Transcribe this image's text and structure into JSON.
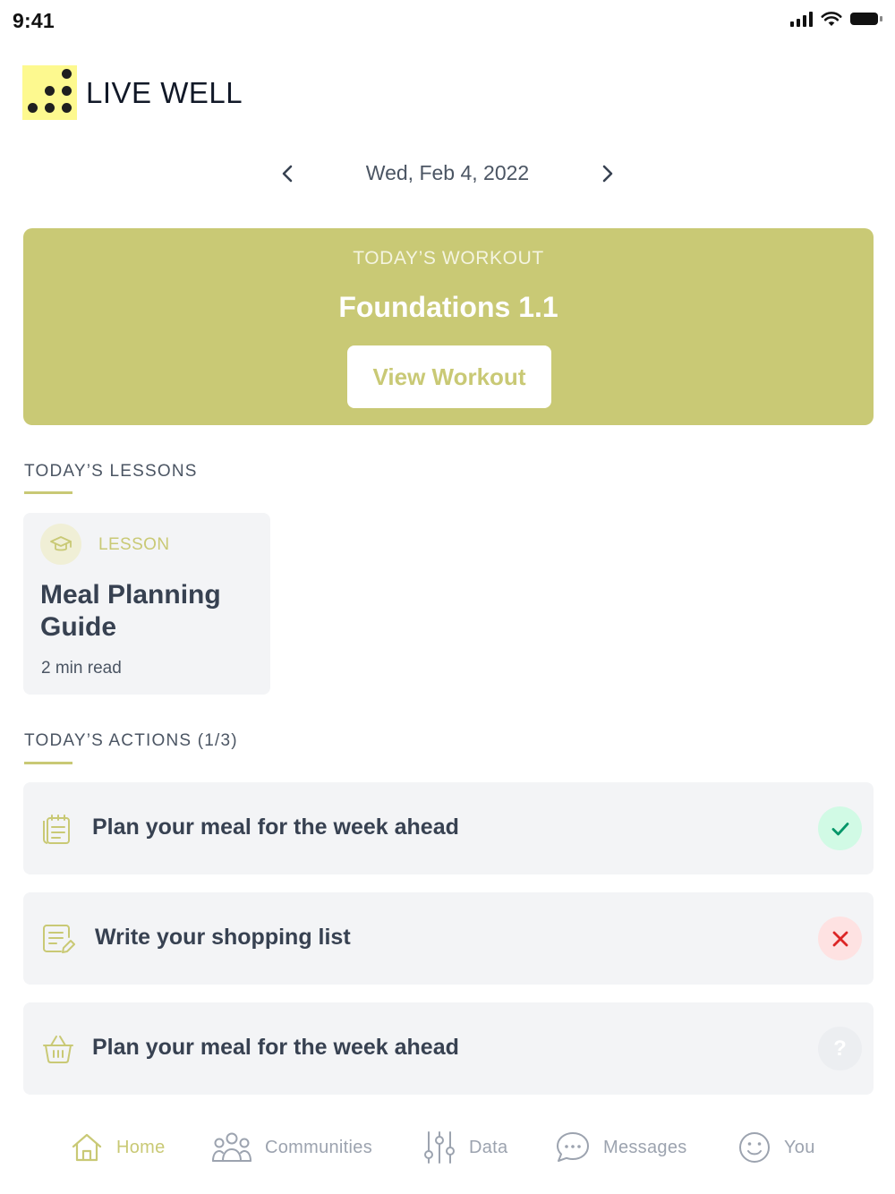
{
  "status_bar": {
    "time": "9:41"
  },
  "brand": {
    "name": "LIVE WELL"
  },
  "date_nav": {
    "date": "Wed, Feb 4, 2022"
  },
  "workout": {
    "eyebrow": "TODAY’S WORKOUT",
    "title": "Foundations 1.1",
    "button_label": "View Workout"
  },
  "lessons": {
    "heading": "TODAY’S LESSONS",
    "items": [
      {
        "tag": "LESSON",
        "title": "Meal Planning Guide",
        "meta": "2 min read",
        "icon": "graduation-cap-icon"
      }
    ]
  },
  "actions": {
    "heading": "TODAY’S ACTIONS (1/3)",
    "items": [
      {
        "label": "Plan your meal for the week ahead",
        "icon": "notepad-icon",
        "status": "done"
      },
      {
        "label": "Write your shopping list",
        "icon": "edit-list-icon",
        "status": "failed"
      },
      {
        "label": "Plan your meal for the week ahead",
        "icon": "basket-icon",
        "status": "unknown",
        "status_glyph": "?"
      }
    ]
  },
  "tabs": [
    {
      "label": "Home",
      "icon": "home-icon",
      "active": true
    },
    {
      "label": "Communities",
      "icon": "people-icon",
      "active": false
    },
    {
      "label": "Data",
      "icon": "sliders-icon",
      "active": false
    },
    {
      "label": "Messages",
      "icon": "chat-bubble-icon",
      "active": false
    },
    {
      "label": "You",
      "icon": "smiley-icon",
      "active": false
    }
  ],
  "colors": {
    "accent": "#c9c975",
    "logo_bg": "#fdf98f",
    "card_bg": "#f3f4f6",
    "success": "#059669",
    "error": "#dc2626"
  }
}
